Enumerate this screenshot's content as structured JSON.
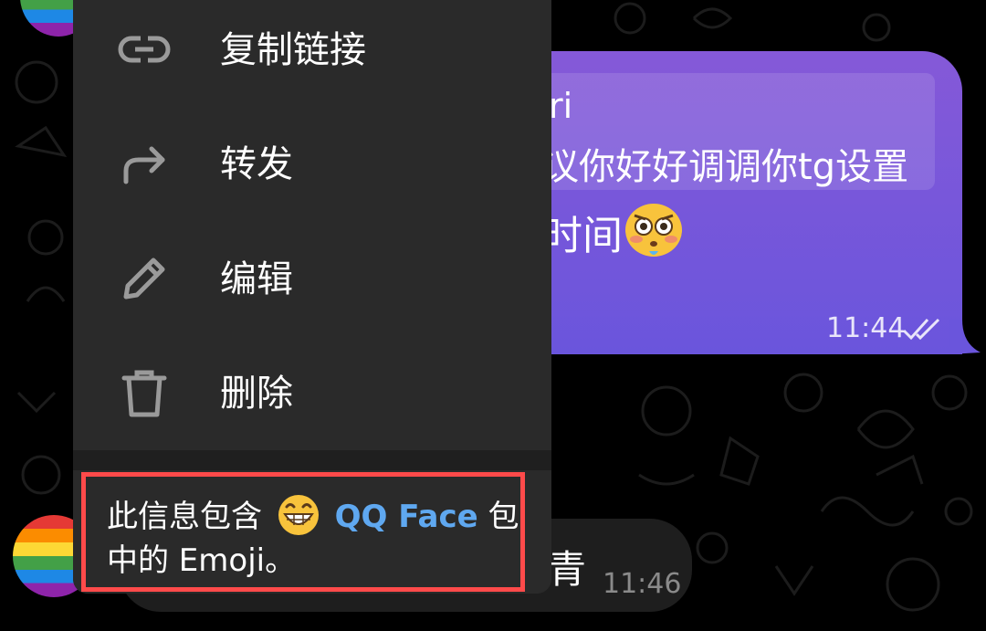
{
  "chat": {
    "outgoing": {
      "reply_name": "ri",
      "reply_text": "议你好好调调你tg设置",
      "message_text": "时间",
      "emoji_icon": "flushed-face-icon",
      "time": "11:44",
      "status_icon": "double-check-icon"
    },
    "incoming": {
      "text": "青",
      "time": "11:46"
    }
  },
  "menu": {
    "items": [
      {
        "label": "复制链接",
        "icon": "link-icon"
      },
      {
        "label": "转发",
        "icon": "forward-icon"
      },
      {
        "label": "编辑",
        "icon": "pencil-icon"
      },
      {
        "label": "删除",
        "icon": "trash-icon"
      }
    ],
    "footer": {
      "prefix": "此信息包含",
      "emoji_icon": "grinning-face-icon",
      "pack_name": "QQ Face",
      "suffix_line1": "包",
      "line2": "中的 Emoji。"
    }
  },
  "colors": {
    "bubble_out": "#7a57d9",
    "menu_bg": "#2a2a2a",
    "link": "#5fa8f0",
    "highlight": "#ff4a4a"
  }
}
